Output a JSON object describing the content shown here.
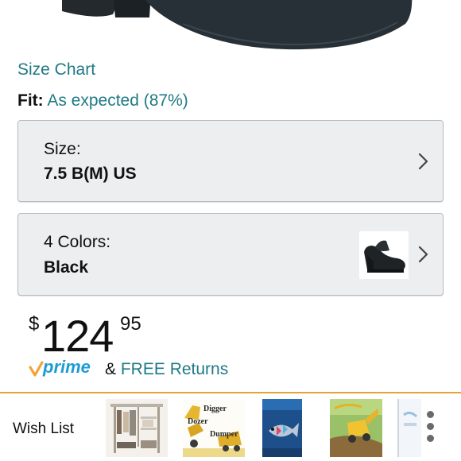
{
  "product": {
    "size_chart_link": "Size Chart",
    "fit": {
      "label": "Fit:",
      "value": "As expected (87%)"
    },
    "size_selector": {
      "label": "Size:",
      "value": "7.5 B(M) US"
    },
    "color_selector": {
      "label": "4 Colors:",
      "value": "Black"
    },
    "price": {
      "currency": "$",
      "whole": "124",
      "cents": "95"
    },
    "shipping": {
      "prime_label": "prime",
      "connector": "&",
      "returns_text": "FREE Returns"
    }
  },
  "bottom_bar": {
    "wish_list_label": "Wish List",
    "book_titles": [
      "Digger",
      "Dozer",
      "Dumper"
    ]
  },
  "colors": {
    "link": "#1f7a85",
    "prime_blue": "#1f9bd3",
    "prime_check": "#f3a33a",
    "divider": "#e7a13b",
    "selector_bg": "#eceeef"
  }
}
